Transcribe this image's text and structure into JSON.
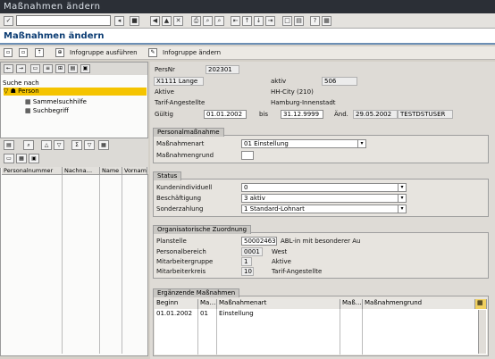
{
  "window": {
    "title": "Maßnahmen ändern"
  },
  "toolbar": {
    "command_value": ""
  },
  "screen": {
    "title": "Maßnahmen ändern"
  },
  "app_toolbar": {
    "execute_label": "Infogruppe ausführen",
    "change_label": "Infogruppe ändern"
  },
  "left": {
    "search_label": "Suche nach",
    "tree": {
      "person": "Person",
      "collective": "Sammelsuchhilfe",
      "keyword": "Suchbegriff"
    },
    "columns": [
      "Personalnummer",
      "Nachna…",
      "Name",
      "Vornam"
    ]
  },
  "header": {
    "persnr_label": "PersNr",
    "persnr_value": "202301",
    "name_value": "X1111 Lange",
    "activity_label": "aktiv",
    "activity_value": "506",
    "status_label": "Aktive",
    "org_value": "HH-City (210)",
    "tarif_label": "Tarif-Angestellte",
    "region_value": "Hamburg-Innenstadt",
    "valid_label": "Gültig",
    "valid_from": "01.01.2002",
    "to_label": "bis",
    "valid_to": "31.12.9999",
    "changed_label": "Änd.",
    "changed_date": "29.05.2002",
    "changed_user": "TESTDSTUSER"
  },
  "group_measures": {
    "title": "Personalmaßnahme",
    "type_label": "Maßnahmenart",
    "type_value": "01 Einstellung",
    "reason_label": "Maßnahmengrund",
    "reason_value": ""
  },
  "group_status": {
    "title": "Status",
    "customer_label": "Kundenindividuell",
    "customer_value": "0",
    "employment_label": "Beschäftigung",
    "employment_value": "3 aktiv",
    "special_label": "Sonderzahlung",
    "special_value": "1 Standard-Lohnart"
  },
  "group_org": {
    "title": "Organisatorische Zuordnung",
    "plan_label": "Planstelle",
    "plan_value": "50002463",
    "plan_text": "ABL-in mit besonderer Au",
    "area_label": "Personalbereich",
    "area_value": "0001",
    "area_text": "West",
    "group_label": "Mitarbeitergruppe",
    "group_value": "1",
    "group_text": "Aktive",
    "circle_label": "Mitarbeiterkreis",
    "circle_value": "10",
    "circle_text": "Tarif-Angestellte"
  },
  "group_extra": {
    "title": "Ergänzende Maßnahmen",
    "columns": [
      "Beginn",
      "Ma…",
      "Maßnahmenart",
      "Maß…",
      "Maßnahmengrund"
    ],
    "rows": [
      {
        "begin": "01.01.2002",
        "code": "01",
        "type": "Einstellung",
        "rcode": "",
        "reason": ""
      }
    ]
  }
}
